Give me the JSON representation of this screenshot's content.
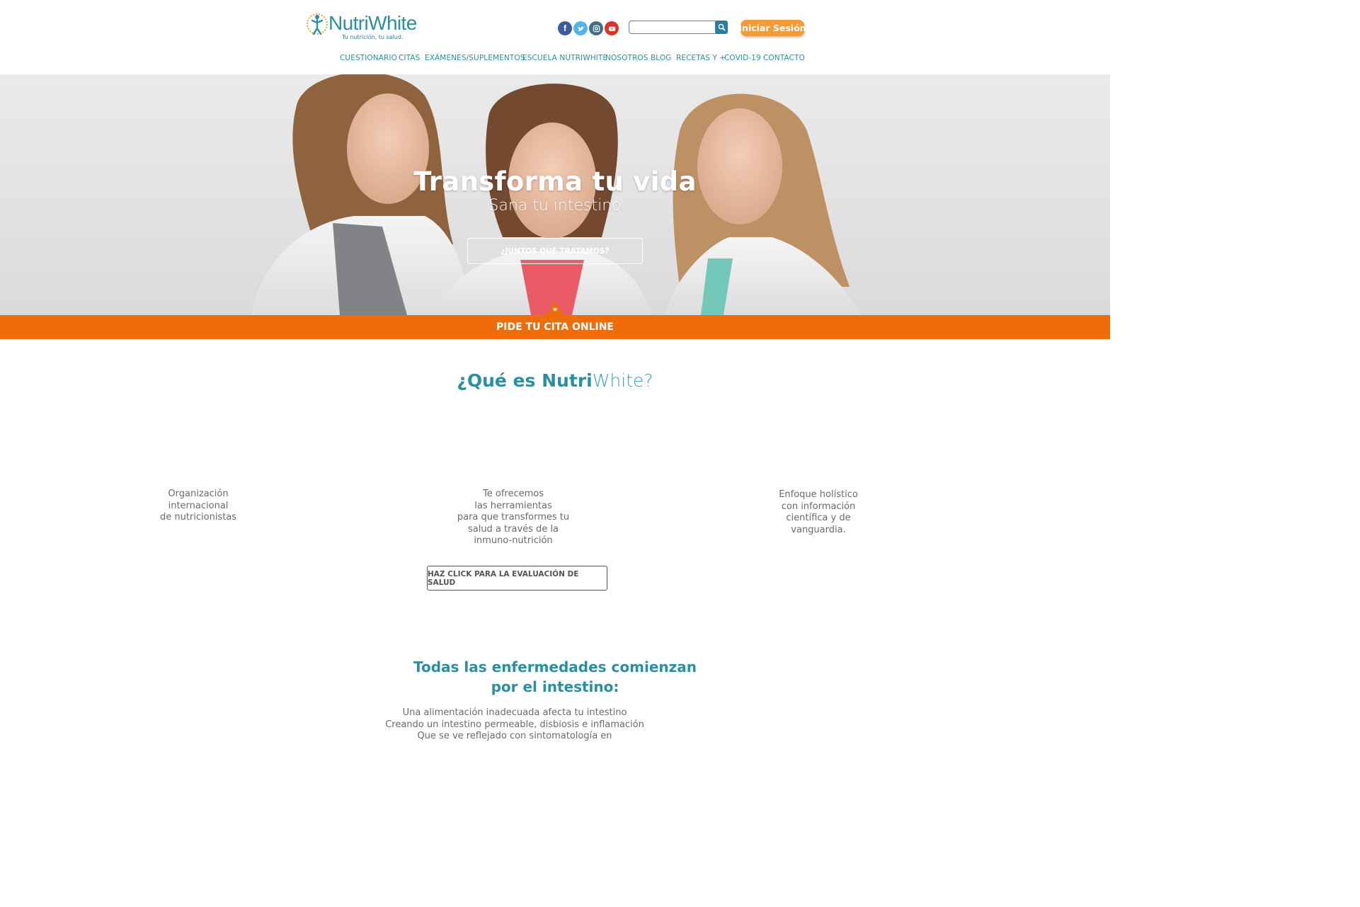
{
  "header": {
    "logo": {
      "name": "NutriWhite",
      "tagline": "Tu nutrición, tu salud."
    },
    "social": [
      {
        "name": "facebook-icon",
        "glyph": "f",
        "color": "#3b5c9e"
      },
      {
        "name": "twitter-icon",
        "glyph": "t",
        "color": "#56b4e5"
      },
      {
        "name": "instagram-icon",
        "glyph": "◎",
        "color": "#3f6d8a"
      },
      {
        "name": "youtube-icon",
        "glyph": "▶",
        "color": "#d8342c"
      }
    ],
    "search": {
      "placeholder": "",
      "value": ""
    },
    "login_label": "Iniciar Sesión"
  },
  "nav": [
    "CUESTIONARIO",
    "CITAS",
    "EXÁMENES/SUPLEMENTOS",
    "ESCUELA NUTRIWHITE",
    "NOSOTROS",
    "BLOG",
    "RECETAS Y +",
    "COVID-19",
    "CONTACTO"
  ],
  "hero": {
    "title": "Transforma tu vida",
    "subtitle": "Sana tu intestino",
    "button": "¿JUNTOS QUÉ TRATAMOS?"
  },
  "cta_bar": {
    "star": "*",
    "label": "PIDE TU CITA ONLINE"
  },
  "what_is": {
    "title_prefix": "¿Qué es ",
    "title_bold": "Nutri",
    "title_light": "White?",
    "features": [
      [
        "Organización",
        "internacional",
        "de nutricionistas"
      ],
      [
        "Te ofrecemos",
        "las herramientas",
        "para que transformes tu",
        "salud a través de la",
        "inmuno-nutrición"
      ],
      [
        "Enfoque holístico",
        "con información",
        "científica y de",
        "vanguardia."
      ]
    ],
    "button": "HAZ CLICK PARA LA EVALUACIÓN DE SALUD"
  },
  "disease": {
    "title_lines": [
      "Todas las enfermedades comienzan",
      "por el intestino:"
    ],
    "text_lines": [
      "Una alimentación inadecuada afecta tu intestino",
      "Creando un intestino permeable, disbiosis e inflamación",
      "Que se ve reflejado con sintomatología en"
    ]
  },
  "colors": {
    "brand_teal": "#2a8fa0",
    "accent_orange": "#ef6c0a",
    "login_orange": "#f39a3a"
  }
}
